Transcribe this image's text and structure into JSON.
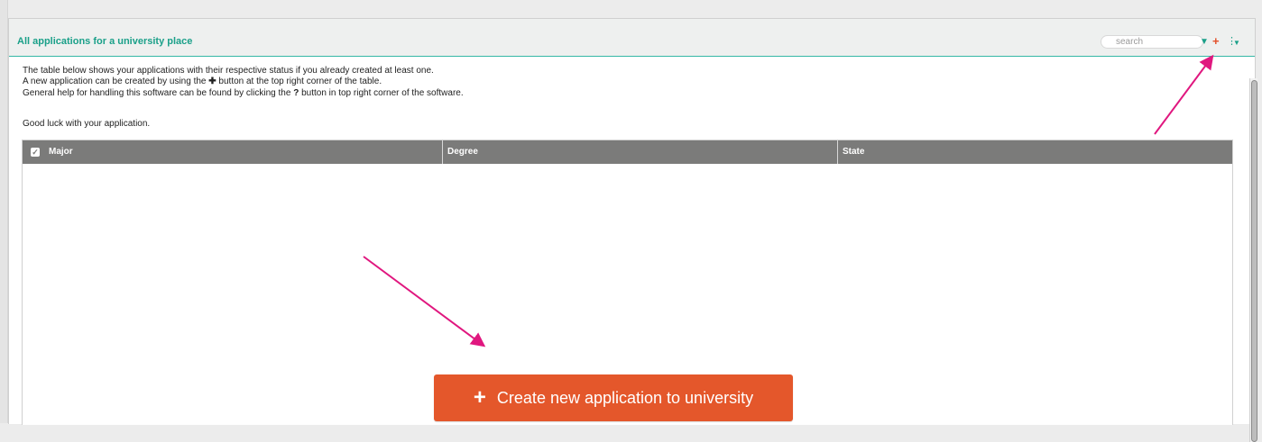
{
  "panel": {
    "title": "All applications for a university place",
    "search_placeholder": "search",
    "icons": {
      "filter": "filter-icon",
      "add": "plus-icon",
      "menu": "vertical-dots-icon",
      "caret": "caret-down-icon"
    }
  },
  "intro": {
    "line1": "The table below shows your applications with their respective status if you already created at least one.",
    "line2_pre": "A new application can be created by using the ",
    "line2_symbol": "✚",
    "line2_post": " button at the top right corner of the table.",
    "line3_pre": "General help for handling this software can be found by clicking the ",
    "line3_symbol": "?",
    "line3_post": " button in top right corner of the software.",
    "good_luck": "Good luck with your application."
  },
  "table": {
    "columns": [
      "Major",
      "Degree",
      "State"
    ],
    "rows": []
  },
  "create_button": {
    "label": "Create new application to university",
    "icon": "plus-icon"
  },
  "colors": {
    "accent": "#1aa089",
    "header_row": "#7b7b7a",
    "create_button": "#e4572b",
    "annotation_arrow": "#e0177f"
  }
}
